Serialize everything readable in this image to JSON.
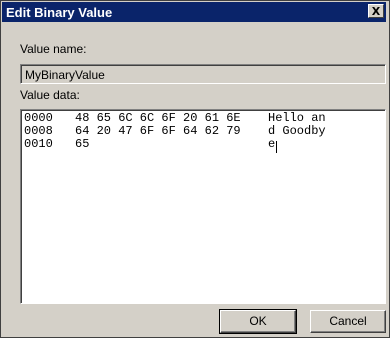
{
  "window": {
    "title": "Edit Binary Value",
    "close_label": "X"
  },
  "value_name": {
    "label": "Value name:",
    "value": "MyBinaryValue"
  },
  "value_data": {
    "label": "Value data:",
    "rows": [
      {
        "offset": "0000",
        "hex": "48 65 6C 6C 6F 20 61 6E",
        "ascii": "Hello an"
      },
      {
        "offset": "0008",
        "hex": "64 20 47 6F 6F 64 62 79",
        "ascii": "d Goodby"
      },
      {
        "offset": "0010",
        "hex": "65",
        "ascii": "e"
      }
    ]
  },
  "buttons": {
    "ok": "OK",
    "cancel": "Cancel"
  }
}
